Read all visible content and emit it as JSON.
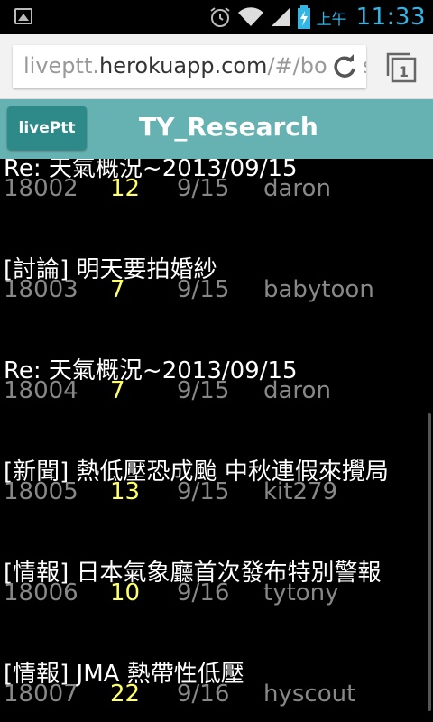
{
  "status_bar": {
    "ampm": "上午",
    "time": "11:33"
  },
  "browser": {
    "url_prefix": "liveptt.",
    "url_host": "herokuapp.com",
    "url_suffix": "/#/boards"
  },
  "header": {
    "brand": "livePtt",
    "title": "TY_Research"
  },
  "posts": [
    {
      "title": "Re: 天氣概況~2013/09/15",
      "id": "18002",
      "push": "12",
      "date": "9/15",
      "author": "daron"
    },
    {
      "title": "[討論] 明天要拍婚紗",
      "id": "18003",
      "push": "7",
      "date": "9/15",
      "author": "babytoon"
    },
    {
      "title": "Re: 天氣概況~2013/09/15",
      "id": "18004",
      "push": "7",
      "date": "9/15",
      "author": "daron"
    },
    {
      "title": "[新聞] 熱低壓恐成颱 中秋連假來攪局",
      "id": "18005",
      "push": "13",
      "date": "9/15",
      "author": "kit279"
    },
    {
      "title": "[情報] 日本氣象廳首次發布特別警報",
      "id": "18006",
      "push": "10",
      "date": "9/16",
      "author": "tytony"
    },
    {
      "title": "[情報] JMA 熱帶性低壓",
      "id": "18007",
      "push": "22",
      "date": "9/16",
      "author": "hyscout"
    }
  ]
}
